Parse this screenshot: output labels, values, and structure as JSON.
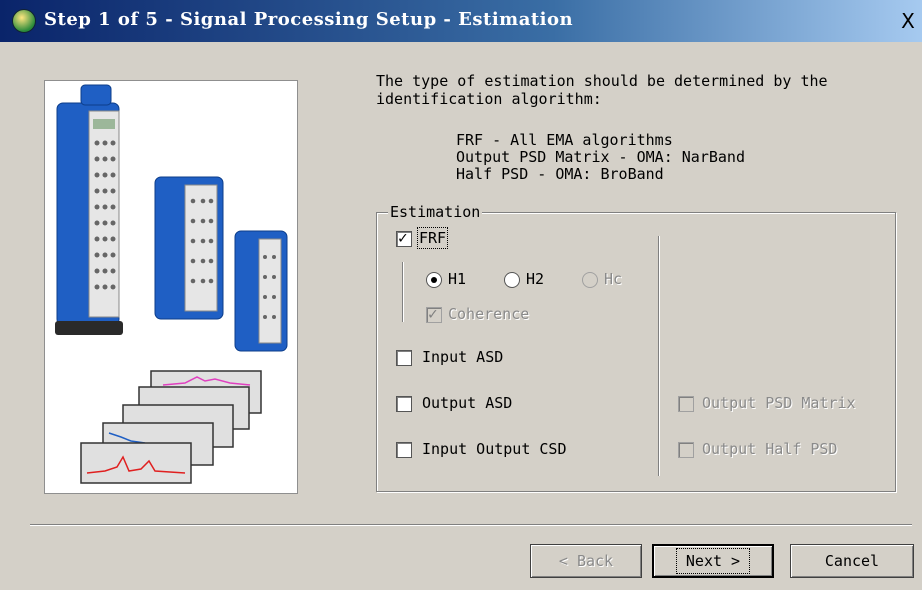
{
  "window": {
    "title": "Step 1 of 5 - Signal Processing Setup - Estimation",
    "close_label": "X"
  },
  "intro": {
    "text_line1": "The type of estimation should be determined by the",
    "text_line2": "identification algorithm:",
    "algorithms": [
      "FRF - All EMA algorithms",
      "Output PSD Matrix - OMA: NarBand",
      "Half PSD - OMA: BroBand"
    ]
  },
  "estimation": {
    "legend": "Estimation",
    "frf": {
      "label": "FRF",
      "checked": true
    },
    "estimators": [
      {
        "label": "H1",
        "selected": true,
        "enabled": true
      },
      {
        "label": "H2",
        "selected": false,
        "enabled": true
      },
      {
        "label": "Hc",
        "selected": false,
        "enabled": false
      }
    ],
    "coherence": {
      "label": "Coherence",
      "checked": true,
      "enabled": false
    },
    "input_asd": {
      "label": "Input ASD",
      "checked": false
    },
    "output_asd": {
      "label": "Output ASD",
      "checked": false
    },
    "input_output_csd": {
      "label": "Input Output CSD",
      "checked": false
    },
    "output_psd_matrix": {
      "label": "Output PSD Matrix",
      "checked": false,
      "enabled": false
    },
    "output_half_psd": {
      "label": "Output Half PSD",
      "checked": false,
      "enabled": false
    }
  },
  "buttons": {
    "back": {
      "label": "< Back",
      "enabled": false
    },
    "next": {
      "label": "Next >",
      "enabled": true
    },
    "cancel": {
      "label": "Cancel",
      "enabled": true
    }
  },
  "colors": {
    "titlebar_start": "#0a246a",
    "titlebar_end": "#a6caf0",
    "window_bg": "#d4d0c8",
    "hardware_blue": "#1f5fc4",
    "spectrum_magenta": "#e040c0",
    "spectrum_red": "#e02020"
  }
}
